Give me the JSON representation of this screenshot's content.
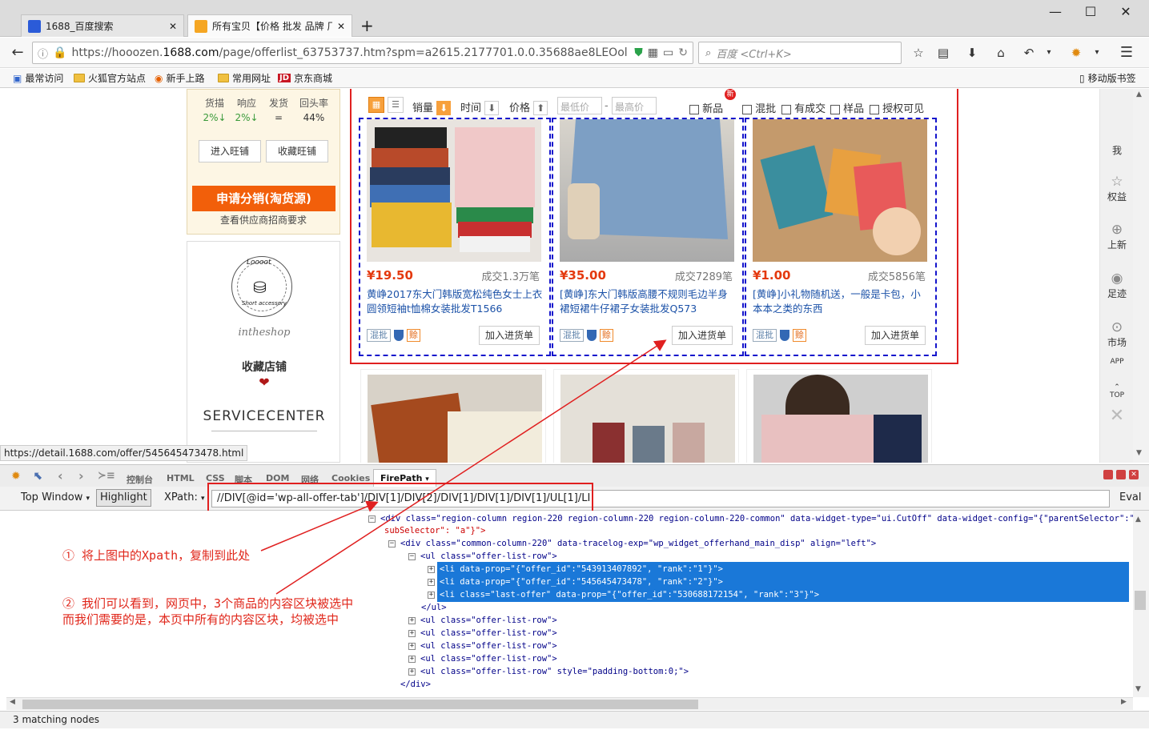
{
  "browser": {
    "tabs": [
      {
        "title": "1688_百度搜索",
        "active": false
      },
      {
        "title": "所有宝贝【价格 批发 品牌 厂",
        "active": true
      }
    ],
    "new_tab_icon": "plus-icon",
    "url_prefix": "https://hooozen.",
    "url_domain": "1688.com",
    "url_path": "/page/offerlist_63753737.htm?spm=a2615.2177701.0.0.35688ae8LEOol",
    "search_placeholder": "百度 <Ctrl+K>",
    "bookmarks": [
      "最常访问",
      "火狐官方站点",
      "新手上路",
      "常用网址",
      "京东商城"
    ],
    "mobile_bookmarks": "移动版书签"
  },
  "seller": {
    "stats": [
      {
        "label": "货描",
        "value": "2%↓"
      },
      {
        "label": "响应",
        "value": "2%↓"
      },
      {
        "label": "发货",
        "value": "="
      },
      {
        "label": "回头率",
        "value": "44%"
      }
    ],
    "buttons": [
      "进入旺铺",
      "收藏旺铺"
    ],
    "offer_button": "申请分销(淘货源)",
    "offer_sub": "查看供应商招商要求",
    "shop_logo_text": "intheshop",
    "logo_ring_text": "Loooot",
    "logo_ring_text2": "Short accessory",
    "favorite_label": "收藏店铺",
    "service_center": "SERVICECENTER"
  },
  "toolbar": {
    "sort_sales": "销量",
    "sort_time": "时间",
    "sort_price": "价格",
    "min_price": "最低价",
    "max_price": "最高价",
    "dash": "-",
    "new_badge": "新",
    "filters": [
      "新品",
      "混批",
      "有成交",
      "样品",
      "授权可见"
    ]
  },
  "products": [
    {
      "price": "¥19.50",
      "sold": "成交1.3万笔",
      "desc": "黄峥2017东大门韩版宽松纯色女士上衣圆领短袖t恤棉女装批发T1566",
      "tag_mix": "混批",
      "tag_pay": "赊",
      "add": "加入进货单"
    },
    {
      "price": "¥35.00",
      "sold": "成交7289笔",
      "desc": "[黄峥]东大门韩版高腰不规则毛边半身裙短裙牛仔裙子女装批发Q573",
      "tag_mix": "混批",
      "tag_pay": "赊",
      "add": "加入进货单"
    },
    {
      "price": "¥1.00",
      "sold": "成交5856笔",
      "desc": "[黄峥]小礼物随机送，一般是卡包，小本本之类的东西",
      "tag_mix": "混批",
      "tag_pay": "赊",
      "add": "加入进货单"
    }
  ],
  "right_sidebar": [
    "我",
    "权益",
    "上新",
    "足迹",
    "市场",
    "APP",
    "TOP"
  ],
  "status_url": "https://detail.1688.com/offer/545645473478.html",
  "devtools": {
    "tabs": [
      "控制台",
      "HTML",
      "CSS",
      "脚本",
      "DOM",
      "网络",
      "Cookies",
      "FirePath"
    ],
    "top_window": "Top Window",
    "highlight": "Highlight",
    "xpath_label": "XPath:",
    "xpath": "//DIV[@id='wp-all-offer-tab']/DIV[1]/DIV[2]/DIV[1]/DIV[1]/DIV[1]/UL[1]/LI",
    "eval": "Eval",
    "html_lines": [
      "<div class=\"region-column region-220 region-column-220 region-column-220-common\" data-widget-type=\"ui.CutOff\" data-widget-config=\"{\"parentSelector\":\"li div.title\",",
      "subSelector\": \"a\"}\">",
      "<div class=\"common-column-220\" data-tracelog-exp=\"wp_widget_offerhand_main_disp\" align=\"left\">",
      "<ul class=\"offer-list-row\">",
      "<li data-prop=\"{\"offer_id\":\"543913407892\", \"rank\":\"1\"}\">",
      "<li data-prop=\"{\"offer_id\":\"545645473478\", \"rank\":\"2\"}\">",
      "<li class=\"last-offer\" data-prop=\"{\"offer_id\":\"530688172154\", \"rank\":\"3\"}\">",
      "</ul>",
      "<ul class=\"offer-list-row\">",
      "<ul class=\"offer-list-row\">",
      "<ul class=\"offer-list-row\">",
      "<ul class=\"offer-list-row\">",
      "<ul class=\"offer-list-row\" style=\"padding-bottom:0;\">",
      "</div>"
    ],
    "status": "3 matching nodes"
  },
  "annotations": {
    "note1": "① 将上图中的Xpath，复制到此处",
    "note2_line1": "② 我们可以看到，网页中，3个商品的内容区块被选中",
    "note2_line2": "而我们需要的是，本页中所有的内容区块，均被选中"
  },
  "colors": {
    "highlight_box": "#e02020",
    "dashed_box": "#1414cc",
    "accent_orange": "#f25f0a",
    "price_red": "#e4390e",
    "selection_blue": "#1a78d8"
  }
}
